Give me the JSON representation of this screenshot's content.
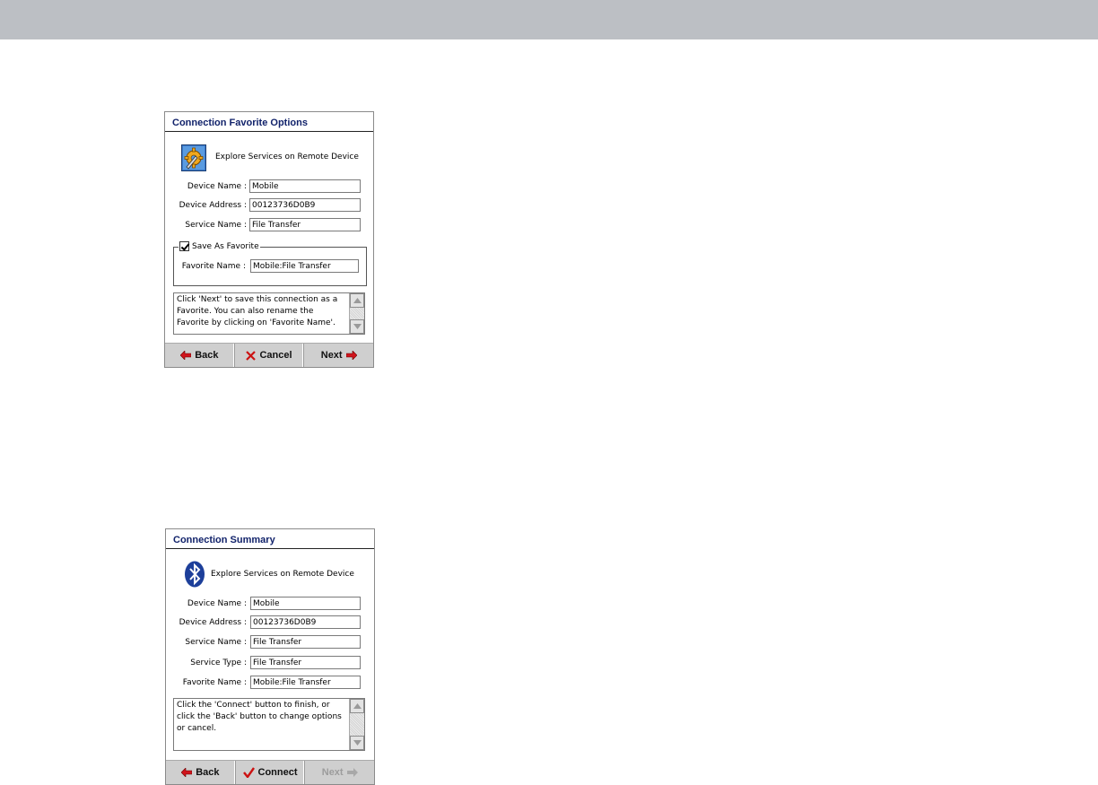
{
  "dialog1": {
    "title": "Connection Favorite Options",
    "header_text": "Explore Services on Remote Device",
    "header_icon": "settings-wrench-icon",
    "fields": [
      {
        "label": "Device Name :",
        "value": "Mobile"
      },
      {
        "label": "Device Address :",
        "value": "00123736D0B9"
      },
      {
        "label": "Service Name :",
        "value": "File Transfer"
      }
    ],
    "favorite_group": {
      "checkbox_label": "Save As Favorite",
      "checked": true,
      "favorite_name_label": "Favorite Name :",
      "favorite_name_value": "Mobile:File Transfer"
    },
    "message": "Click 'Next' to save this connection as a Favorite.  You can also rename the Favorite by clicking on 'Favorite Name'.",
    "buttons": {
      "back": "Back",
      "cancel": "Cancel",
      "next": "Next"
    }
  },
  "dialog2": {
    "title": "Connection Summary",
    "header_text": "Explore Services on Remote Device",
    "header_icon": "bluetooth-icon",
    "fields": [
      {
        "label": "Device Name :",
        "value": "Mobile"
      },
      {
        "label": "Device Address :",
        "value": "00123736D0B9"
      },
      {
        "label": "Service Name :",
        "value": "File Transfer"
      },
      {
        "label": "Service Type :",
        "value": "File Transfer"
      },
      {
        "label": "Favorite Name :",
        "value": "Mobile:File Transfer"
      }
    ],
    "message": "Click the 'Connect' button to finish, or click the 'Back' button to change options or cancel.",
    "buttons": {
      "back": "Back",
      "connect": "Connect",
      "next": "Next"
    },
    "next_disabled": true
  },
  "colors": {
    "title_text": "#12236b",
    "arrow_red": "#d0141c",
    "check_red": "#cc1111",
    "bluetooth_blue": "#1d3f9a",
    "footer_bg": "#cfcfcf",
    "top_bar": "#bcbfc4"
  }
}
